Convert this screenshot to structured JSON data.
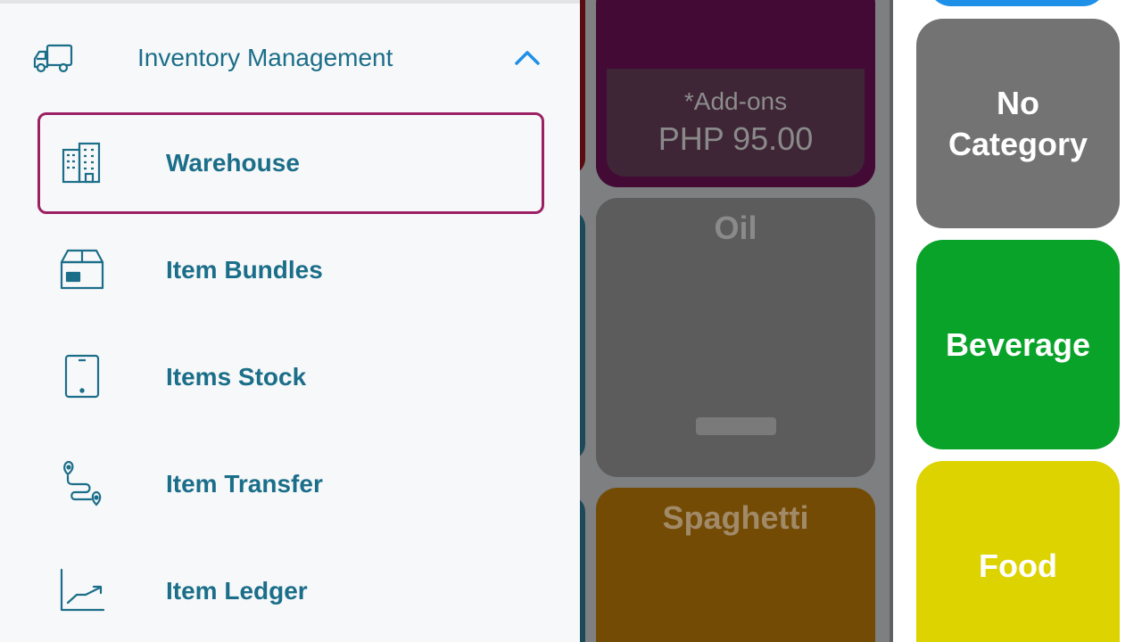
{
  "drawer": {
    "section": {
      "label": "Inventory Management",
      "icon": "truck-icon",
      "expanded": true
    },
    "items": [
      {
        "label": "Warehouse",
        "icon": "buildings-icon",
        "selected": true
      },
      {
        "label": "Item Bundles",
        "icon": "box-icon",
        "selected": false
      },
      {
        "label": "Items Stock",
        "icon": "tablet-icon",
        "selected": false
      },
      {
        "label": "Item Transfer",
        "icon": "route-icon",
        "selected": false
      },
      {
        "label": "Item Ledger",
        "icon": "trend-chart-icon",
        "selected": false
      }
    ]
  },
  "products": [
    {
      "name": "*Add-ons",
      "price": "PHP 95.00"
    },
    {
      "name": "Oil"
    },
    {
      "name": "Spaghetti"
    }
  ],
  "categories": [
    {
      "label": "No Category",
      "color": "#737373"
    },
    {
      "label": "Beverage",
      "color": "#0aa32a"
    },
    {
      "label": "Food",
      "color": "#ddd300"
    }
  ],
  "colors": {
    "accent": "#1b6e89",
    "selected_border": "#9b2164",
    "chevron": "#1e90e8"
  }
}
